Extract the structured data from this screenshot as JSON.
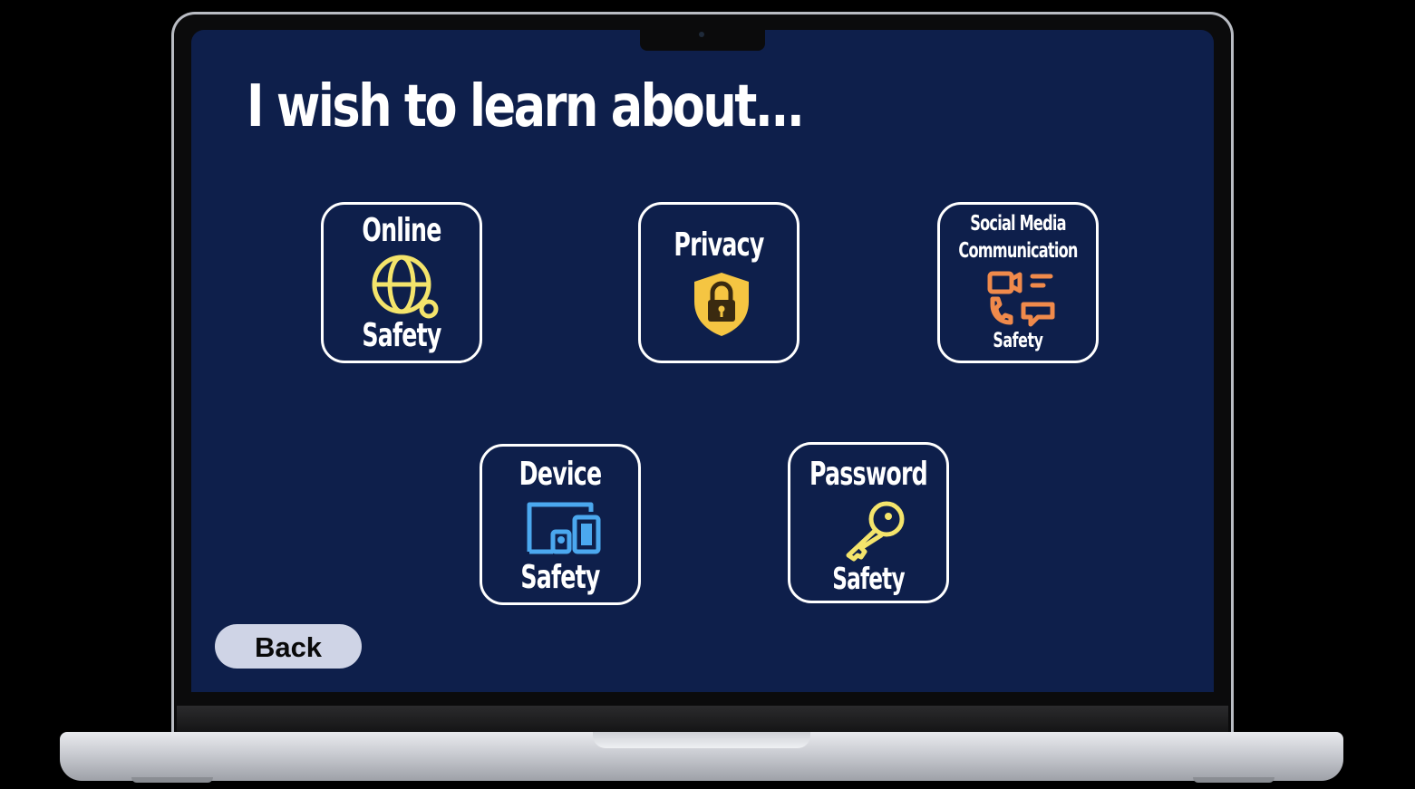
{
  "heading": "I wish to learn about...",
  "topics": [
    {
      "id": "online-safety",
      "line1": "Online",
      "line2": "Safety",
      "icon": "globe-icon",
      "icon_color": "#f4e46b"
    },
    {
      "id": "privacy",
      "line1": "Privacy",
      "icon": "lock-shield-icon",
      "icon_color": "#f5c542"
    },
    {
      "id": "social-media-communication-safety",
      "line1": "Social Media",
      "line2": "Communication",
      "line3": "Safety",
      "icon": "communication-icon",
      "icon_color": "#f08a4b"
    },
    {
      "id": "device-safety",
      "line1": "Device",
      "line2": "Safety",
      "icon": "devices-icon",
      "icon_color": "#4ba8ef"
    },
    {
      "id": "password-safety",
      "line1": "Password",
      "line2": "Safety",
      "icon": "key-icon",
      "icon_color": "#f4e46b"
    }
  ],
  "back_label": "Back",
  "colors": {
    "screen_bg": "#0e1f4b",
    "tile_border": "#ffffff",
    "back_button_bg": "#cfd4e6"
  }
}
